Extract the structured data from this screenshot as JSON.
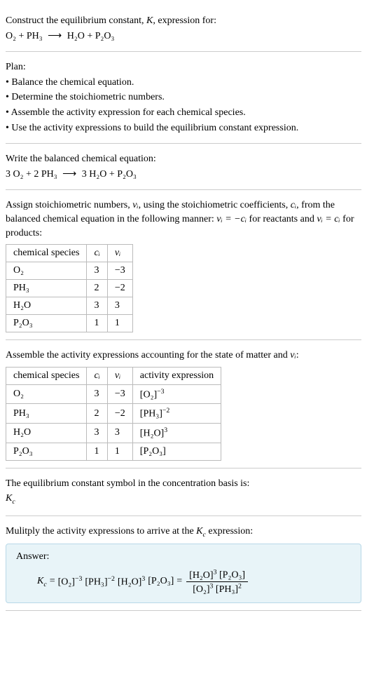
{
  "intro": {
    "line1_a": "Construct the equilibrium constant, ",
    "line1_b": "K",
    "line1_c": ", expression for:",
    "eq_lhs": "O₂ + PH₃",
    "arrow": "⟶",
    "eq_rhs": "H₂O + P₂O₃"
  },
  "plan": {
    "heading": "Plan:",
    "b1": "• Balance the chemical equation.",
    "b2": "• Determine the stoichiometric numbers.",
    "b3": "• Assemble the activity expression for each chemical species.",
    "b4": "• Use the activity expressions to build the equilibrium constant expression."
  },
  "balanced": {
    "heading": "Write the balanced chemical equation:",
    "eq_lhs": "3 O₂ + 2 PH₃",
    "arrow": "⟶",
    "eq_rhs": "3 H₂O + P₂O₃"
  },
  "stoich": {
    "text_a": "Assign stoichiometric numbers, ",
    "nu_i": "νᵢ",
    "text_b": ", using the stoichiometric coefficients, ",
    "c_i": "cᵢ",
    "text_c": ", from the balanced chemical equation in the following manner: ",
    "rel1": "νᵢ = −cᵢ",
    "text_d": " for reactants and ",
    "rel2": "νᵢ = cᵢ",
    "text_e": " for products:",
    "h1": "chemical species",
    "h2": "cᵢ",
    "h3": "νᵢ",
    "r1c1": "O₂",
    "r1c2": "3",
    "r1c3": "−3",
    "r2c1": "PH₃",
    "r2c2": "2",
    "r2c3": "−2",
    "r3c1": "H₂O",
    "r3c2": "3",
    "r3c3": "3",
    "r4c1": "P₂O₃",
    "r4c2": "1",
    "r4c3": "1"
  },
  "activity": {
    "text_a": "Assemble the activity expressions accounting for the state of matter and ",
    "nu_i": "νᵢ",
    "text_b": ":",
    "h1": "chemical species",
    "h2": "cᵢ",
    "h3": "νᵢ",
    "h4": "activity expression",
    "r1c1": "O₂",
    "r1c2": "3",
    "r1c3": "−3",
    "r1c4_base": "[O₂]",
    "r1c4_exp": "−3",
    "r2c1": "PH₃",
    "r2c2": "2",
    "r2c3": "−2",
    "r2c4_base": "[PH₃]",
    "r2c4_exp": "−2",
    "r3c1": "H₂O",
    "r3c2": "3",
    "r3c3": "3",
    "r3c4_base": "[H₂O]",
    "r3c4_exp": "3",
    "r4c1": "P₂O₃",
    "r4c2": "1",
    "r4c3": "1",
    "r4c4": "[P₂O₃]"
  },
  "symbol": {
    "text": "The equilibrium constant symbol in the concentration basis is:",
    "kc": "K",
    "kc_sub": "c"
  },
  "multiply": {
    "text_a": "Mulitply the activity expressions to arrive at the ",
    "kc": "K",
    "kc_sub": "c",
    "text_b": " expression:"
  },
  "answer": {
    "label": "Answer:",
    "kc": "K",
    "kc_sub": "c",
    "eq": " = ",
    "t1_base": "[O₂]",
    "t1_exp": "−3",
    "sp": " ",
    "t2_base": "[PH₃]",
    "t2_exp": "−2",
    "t3_base": "[H₂O]",
    "t3_exp": "3",
    "t4": "[P₂O₃]",
    "eq2": " = ",
    "num_a_base": "[H₂O]",
    "num_a_exp": "3",
    "num_b": "[P₂O₃]",
    "den_a_base": "[O₂]",
    "den_a_exp": "3",
    "den_b_base": "[PH₃]",
    "den_b_exp": "2"
  }
}
